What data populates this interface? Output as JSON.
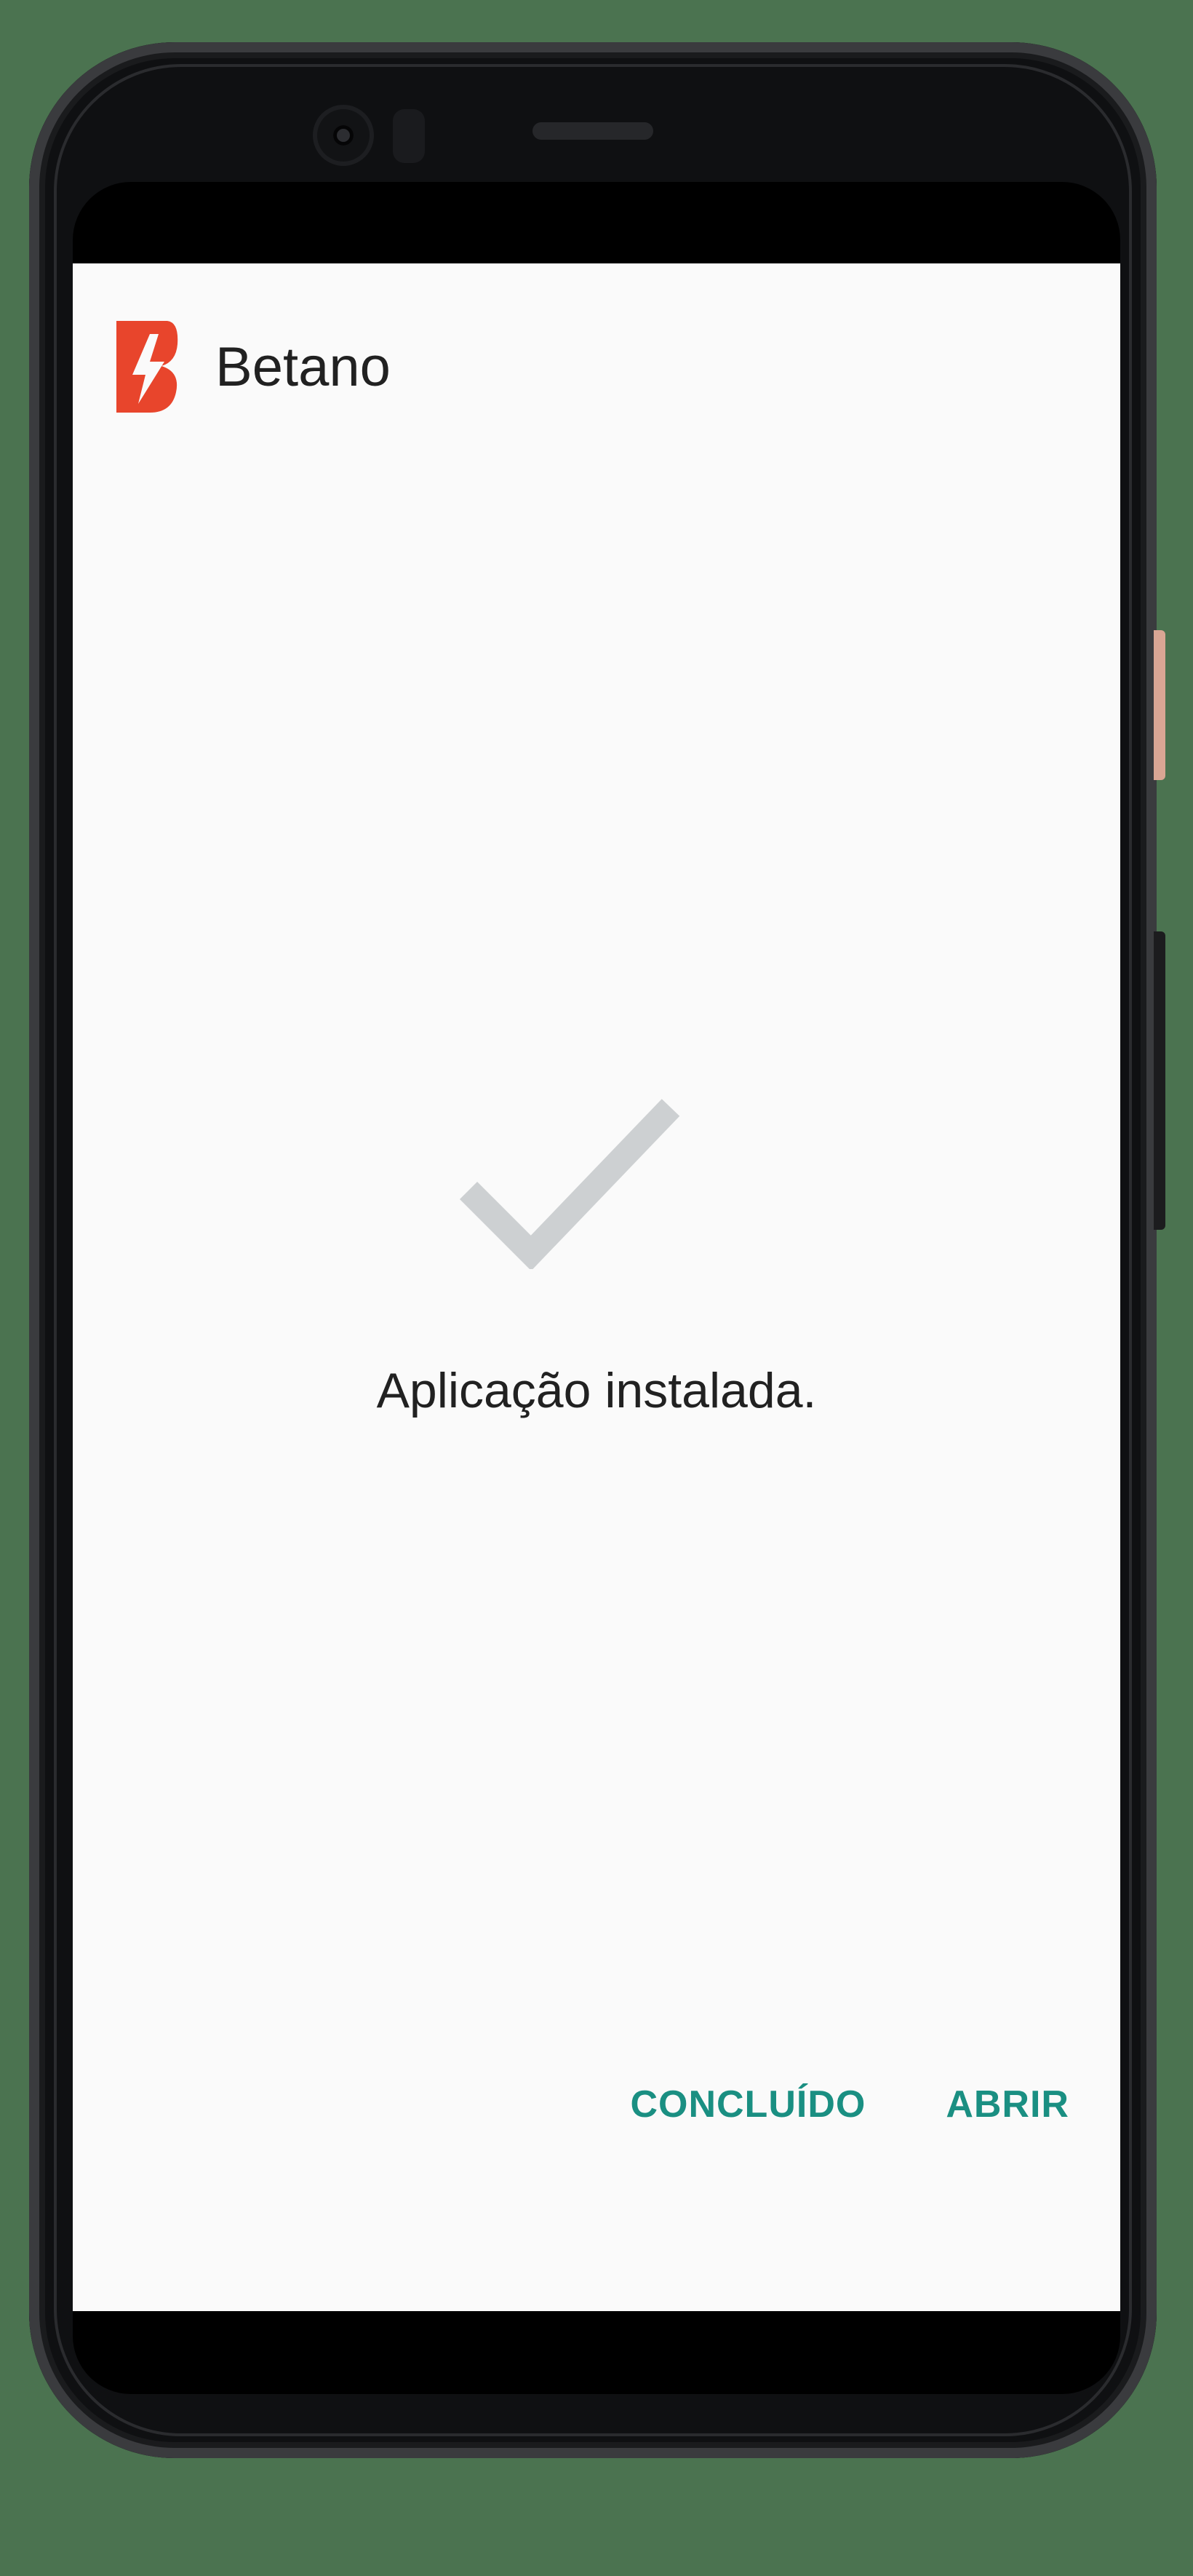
{
  "app": {
    "name": "Betano",
    "logo_color": "#e8452c"
  },
  "install_status": {
    "icon": "check-icon",
    "icon_color": "#cdd0d2",
    "message": "Aplicação instalada."
  },
  "actions": {
    "done_label": "CONCLUÍDO",
    "open_label": "ABRIR",
    "accent_color": "#1a8f82"
  },
  "colors": {
    "background": "#4b7350",
    "screen": "#fafafa",
    "text": "#212121"
  }
}
